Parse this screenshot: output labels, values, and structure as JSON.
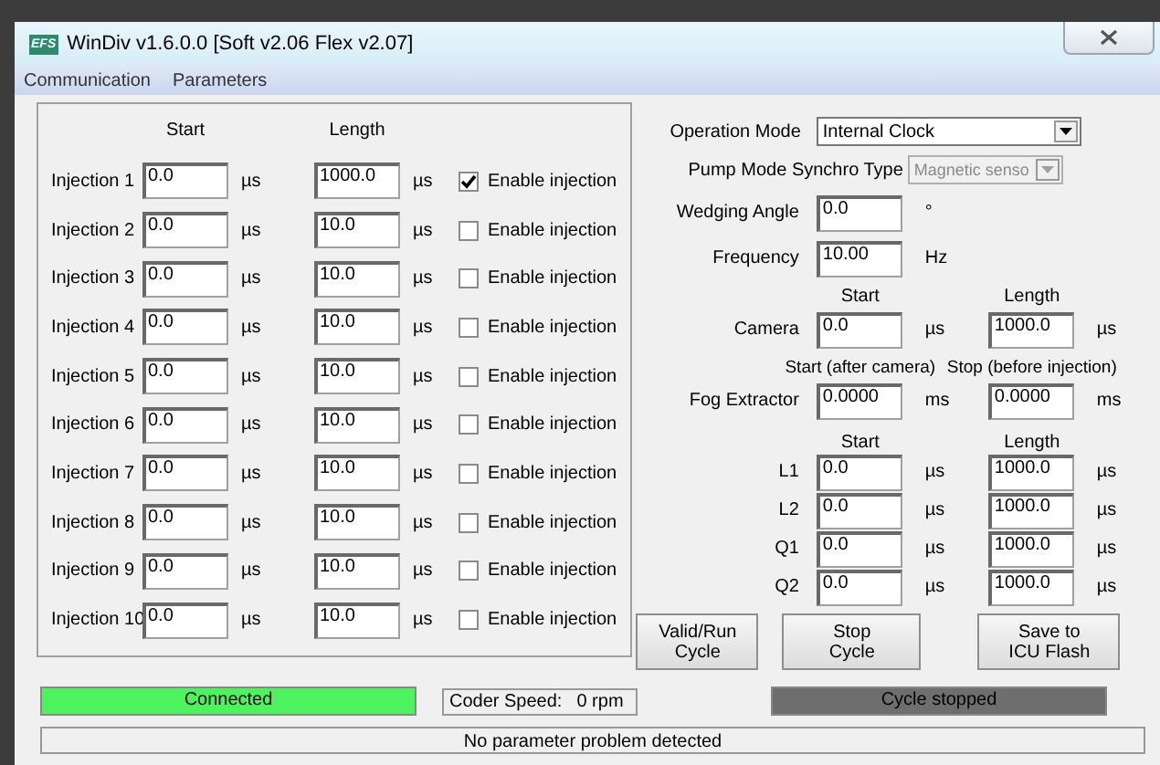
{
  "window": {
    "logo": "EFS",
    "title": "WinDiv v1.6.0.0 [Soft v2.06 Flex v2.07]"
  },
  "menu": [
    {
      "label": "Communication"
    },
    {
      "label": "Parameters"
    }
  ],
  "injections": {
    "headers": [
      "Start",
      "Length"
    ],
    "rows": [
      {
        "label": "Injection 1",
        "start": "0.0",
        "start_unit": "µs",
        "length": "1000.0",
        "length_unit": "µs",
        "option": "Enable injection",
        "checked": true
      },
      {
        "label": "Injection 2",
        "start": "0.0",
        "start_unit": "µs",
        "length": "10.0",
        "length_unit": "µs",
        "option": "Enable injection",
        "checked": false
      },
      {
        "label": "Injection 3",
        "start": "0.0",
        "start_unit": "µs",
        "length": "10.0",
        "length_unit": "µs",
        "option": "Enable injection",
        "checked": false
      },
      {
        "label": "Injection 4",
        "start": "0.0",
        "start_unit": "µs",
        "length": "10.0",
        "length_unit": "µs",
        "option": "Enable injection",
        "checked": false
      },
      {
        "label": "Injection 5",
        "start": "0.0",
        "start_unit": "µs",
        "length": "10.0",
        "length_unit": "µs",
        "option": "Enable injection",
        "checked": false
      },
      {
        "label": "Injection 6",
        "start": "0.0",
        "start_unit": "µs",
        "length": "10.0",
        "length_unit": "µs",
        "option": "Enable injection",
        "checked": false
      },
      {
        "label": "Injection 7",
        "start": "0.0",
        "start_unit": "µs",
        "length": "10.0",
        "length_unit": "µs",
        "option": "Enable injection",
        "checked": false
      },
      {
        "label": "Injection 8",
        "start": "0.0",
        "start_unit": "µs",
        "length": "10.0",
        "length_unit": "µs",
        "option": "Enable injection",
        "checked": false
      },
      {
        "label": "Injection 9",
        "start": "0.0",
        "start_unit": "µs",
        "length": "10.0",
        "length_unit": "µs",
        "option": "Enable injection",
        "checked": false
      },
      {
        "label": "Injection 10",
        "start": "0.0",
        "start_unit": "µs",
        "length": "10.0",
        "length_unit": "µs",
        "option": "Enable injection",
        "checked": false
      }
    ]
  },
  "operation_mode": {
    "label": "Operation Mode",
    "value": "Internal Clock",
    "disabled": false
  },
  "pump_mode_synchro_type": {
    "label": "Pump Mode Synchro Type",
    "value": "Magnetic senso",
    "disabled": true
  },
  "wedging_angle": {
    "label": "Wedging Angle",
    "value": "0.0",
    "unit": "°"
  },
  "frequency": {
    "label": "Frequency",
    "value": "10.00",
    "unit": "Hz"
  },
  "camera": {
    "headers": [
      "Start",
      "Length"
    ],
    "rows": [
      {
        "label": "Camera",
        "start": "0.0",
        "start_unit": "µs",
        "length": "1000.0",
        "length_unit": "µs"
      }
    ]
  },
  "fog_extractor": {
    "headers": [
      "Start (after camera)",
      "Stop (before injection)"
    ],
    "rows": [
      {
        "label": "Fog Extractor",
        "start": "0.0000",
        "start_unit": "ms",
        "length": "0.0000",
        "length_unit": "ms"
      }
    ]
  },
  "lasers": {
    "headers": [
      "Start",
      "Length"
    ],
    "rows": [
      {
        "label": "L1",
        "start": "0.0",
        "start_unit": "µs",
        "length": "1000.0",
        "length_unit": "µs"
      },
      {
        "label": "L2",
        "start": "0.0",
        "start_unit": "µs",
        "length": "1000.0",
        "length_unit": "µs"
      },
      {
        "label": "Q1",
        "start": "0.0",
        "start_unit": "µs",
        "length": "1000.0",
        "length_unit": "µs"
      },
      {
        "label": "Q2",
        "start": "0.0",
        "start_unit": "µs",
        "length": "1000.0",
        "length_unit": "µs"
      }
    ]
  },
  "buttons": [
    {
      "lines": [
        "Valid/Run",
        "Cycle"
      ]
    },
    {
      "lines": [
        "Stop",
        "Cycle"
      ]
    },
    {
      "lines": [
        "Save to",
        "ICU Flash"
      ]
    }
  ],
  "status": {
    "connection": {
      "text": "Connected",
      "connected": true
    },
    "coder_speed": {
      "label": "Coder Speed:",
      "value": "0 rpm"
    },
    "cycle": {
      "text": "Cycle stopped",
      "running": false
    },
    "message": "No parameter problem detected"
  }
}
